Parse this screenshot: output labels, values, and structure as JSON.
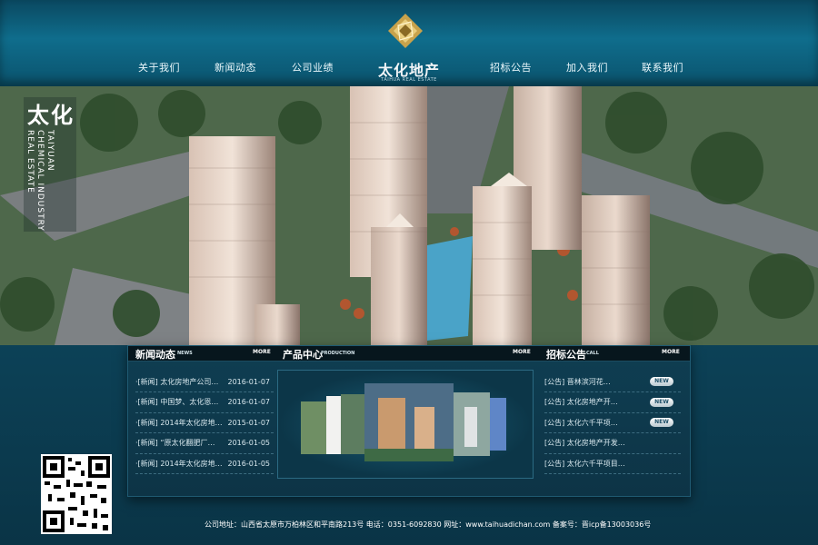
{
  "header": {
    "nav_left": [
      "关于我们",
      "新闻动态",
      "公司业绩"
    ],
    "nav_right": [
      "招标公告",
      "加入我们",
      "联系我们"
    ],
    "logo_text": "太化地产",
    "logo_sub": "TAIHUA REAL ESTATE"
  },
  "hero": {
    "brand_cn": "太化",
    "brand_en": "TAIYUAN\nCHEMICAL INDUSTRY\nREAL ESTATE"
  },
  "news": {
    "title": "新闻动态",
    "sub": "NEWS",
    "more": "MORE",
    "items": [
      {
        "text": "·[新闻]  太化房地产公司…",
        "date": "2016-01-07"
      },
      {
        "text": "·[新闻]  中国梦、太化恩…",
        "date": "2016-01-07"
      },
      {
        "text": "·[新闻]  2014年太化房地…",
        "date": "2015-01-07"
      },
      {
        "text": "·[新闻]  “原太化翻肥厂…",
        "date": "2016-01-05"
      },
      {
        "text": "·[新闻]  2014年太化房地…",
        "date": "2016-01-05"
      }
    ]
  },
  "products": {
    "title": "产品中心",
    "sub": "PRODUCTION",
    "more": "MORE"
  },
  "tenders": {
    "title": "招标公告",
    "sub": "CALL",
    "more": "MORE",
    "badge": "NEW",
    "items": [
      {
        "text": "[公告]  晋林滨河花…",
        "new": true
      },
      {
        "text": "[公告]  太化房地产开…",
        "new": true
      },
      {
        "text": "[公告]  太化六千平项…",
        "new": true
      },
      {
        "text": "[公告]  太化房地产开发…",
        "new": false
      },
      {
        "text": "[公告]  太化六千平项目…",
        "new": false
      }
    ]
  },
  "footer": {
    "text": "公司地址：山西省太原市万柏林区和平南路213号   电话：0351-6092830   网址：www.taihuadichan.com   备案号：晋icp备13003036号"
  },
  "colors": {
    "header": "#0f6d8c",
    "panel": "#0f3e52",
    "background": "#0b3547"
  }
}
